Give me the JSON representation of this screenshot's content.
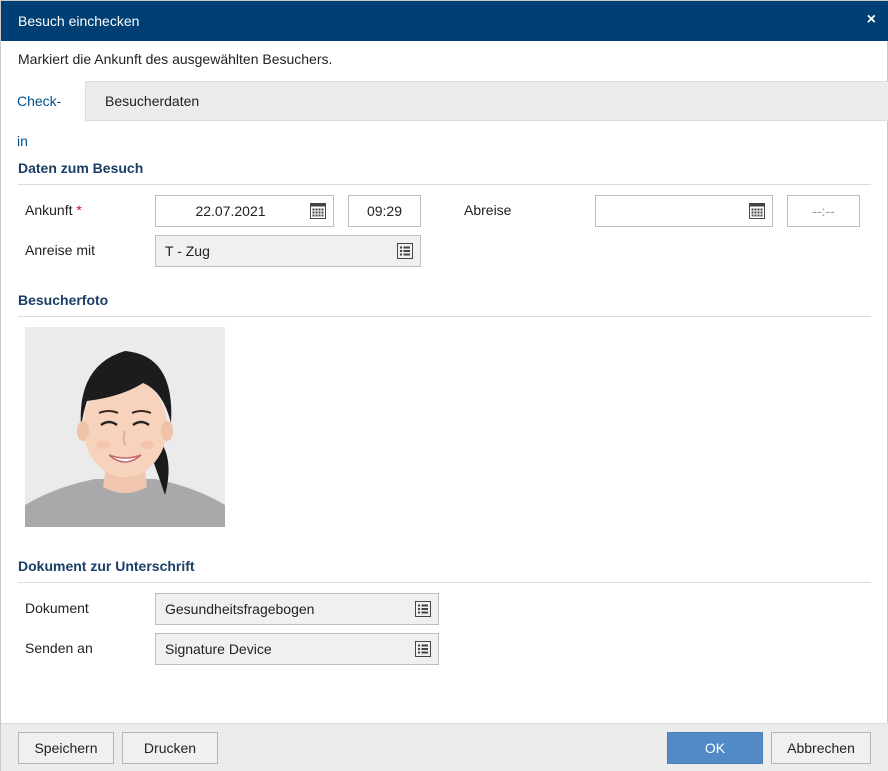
{
  "dialog": {
    "title": "Besuch einchecken",
    "close_glyph": "×",
    "description": "Markiert die Ankunft des ausgewählten Besuchers."
  },
  "tabs": [
    {
      "label": "Check-in",
      "active": true
    },
    {
      "label": "Besucherdaten",
      "active": false
    }
  ],
  "visit": {
    "section_title": "Daten zum Besuch",
    "arrival_label": "Ankunft",
    "required_marker": "*",
    "arrival_date": "22.07.2021",
    "arrival_time": "09:29",
    "departure_label": "Abreise",
    "departure_date": "",
    "departure_time_placeholder": "--:--",
    "travel_label": "Anreise mit",
    "travel_value": "T - Zug"
  },
  "photo": {
    "section_title": "Besucherfoto"
  },
  "document": {
    "section_title": "Dokument zur Unterschrift",
    "document_label": "Dokument",
    "document_value": "Gesundheitsfragebogen",
    "send_to_label": "Senden an",
    "send_to_value": "Signature Device"
  },
  "footer": {
    "save_label": "Speichern",
    "print_label": "Drucken",
    "ok_label": "OK",
    "cancel_label": "Abbrechen"
  },
  "colors": {
    "titlebar": "#003f73",
    "section_title": "#1a3e66",
    "active_tab_text": "#00508c",
    "required": "#c8102e",
    "primary_button": "#5289c7"
  },
  "icons": {
    "calendar": "calendar-icon",
    "list": "list-icon",
    "close": "close-icon"
  }
}
